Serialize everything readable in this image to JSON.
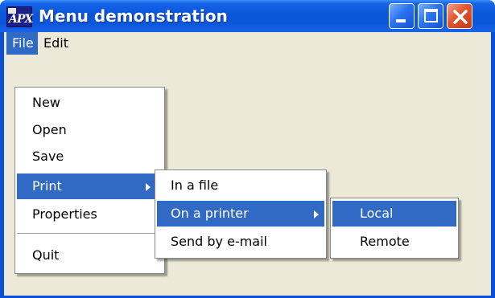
{
  "window": {
    "title": "Menu demonstration",
    "icon": "app-icon"
  },
  "title_buttons": {
    "minimize_icon": "minimize-icon",
    "maximize_icon": "maximize-icon",
    "close_icon": "close-icon"
  },
  "menubar": {
    "items": [
      "File",
      "Edit"
    ],
    "open_menu": "File"
  },
  "file_menu": {
    "items": [
      "New",
      "Open",
      "Save",
      "Print",
      "Properties",
      "Quit"
    ],
    "highlighted": "Print"
  },
  "print_submenu": {
    "items": [
      "In a file",
      "On a printer",
      "Send by e-mail"
    ],
    "highlighted": "On a printer"
  },
  "printer_submenu": {
    "items": [
      "Local",
      "Remote"
    ],
    "highlighted": "Local"
  },
  "colors": {
    "titlebar": "#0a55d8",
    "highlight": "#316ac5",
    "client_bg": "#ece9d8",
    "close_button": "#e2542f"
  }
}
